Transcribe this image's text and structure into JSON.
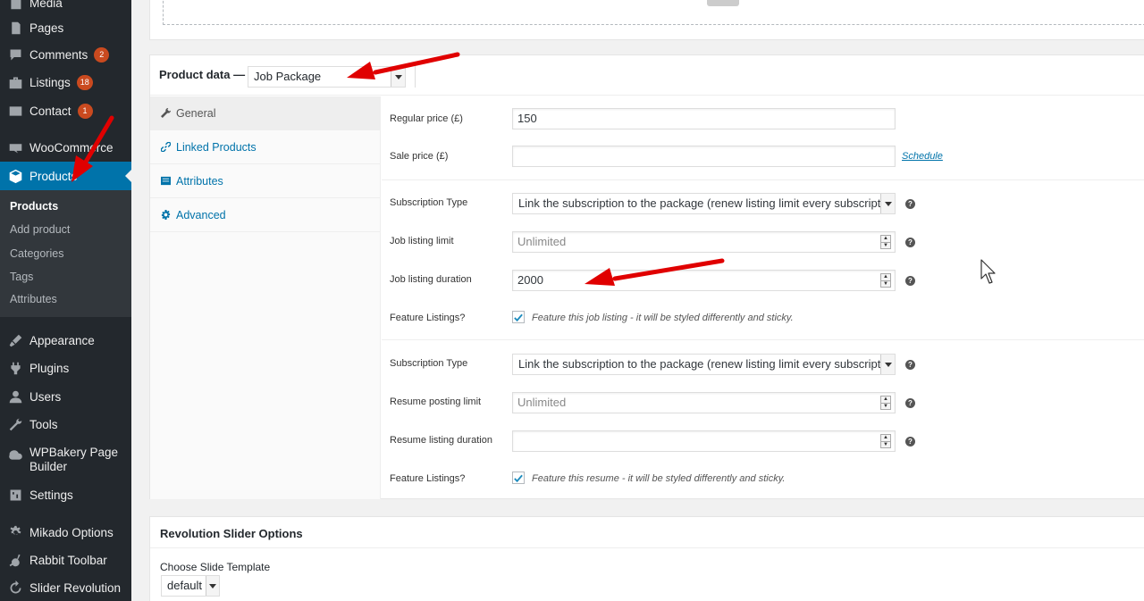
{
  "sidebar": {
    "items": [
      {
        "label": "Media",
        "icon": "media-icon"
      },
      {
        "label": "Pages",
        "icon": "pages-icon"
      },
      {
        "label": "Comments",
        "icon": "comments-icon",
        "badge": "2"
      },
      {
        "label": "Listings",
        "icon": "listings-icon",
        "badge": "18"
      },
      {
        "label": "Contact",
        "icon": "contact-icon",
        "badge": "1"
      },
      {
        "label": "WooCommerce",
        "icon": "woocommerce-icon"
      },
      {
        "label": "Products",
        "icon": "products-icon"
      },
      {
        "label": "Appearance",
        "icon": "appearance-icon"
      },
      {
        "label": "Plugins",
        "icon": "plugins-icon"
      },
      {
        "label": "Users",
        "icon": "users-icon"
      },
      {
        "label": "Tools",
        "icon": "tools-icon"
      },
      {
        "label": "WPBakery Page Builder",
        "icon": "wpbakery-icon"
      },
      {
        "label": "Settings",
        "icon": "settings-icon"
      },
      {
        "label": "Mikado Options",
        "icon": "gear-icon"
      },
      {
        "label": "Rabbit Toolbar",
        "icon": "rabbit-icon"
      },
      {
        "label": "Slider Revolution",
        "icon": "refresh-icon"
      }
    ],
    "submenu": [
      "Products",
      "Add product",
      "Categories",
      "Tags",
      "Attributes"
    ]
  },
  "product_data": {
    "title": "Product data —",
    "type_value": "Job Package",
    "tabs": [
      {
        "label": "General",
        "icon": "wrench-icon"
      },
      {
        "label": "Linked Products",
        "icon": "link-icon"
      },
      {
        "label": "Attributes",
        "icon": "list-icon"
      },
      {
        "label": "Advanced",
        "icon": "gear-icon"
      }
    ],
    "general": {
      "regular_price_label": "Regular price (£)",
      "regular_price_value": "150",
      "sale_price_label": "Sale price (£)",
      "sale_price_value": "",
      "schedule_link": "Schedule"
    },
    "job": {
      "subscription_type_label": "Subscription Type",
      "subscription_type_value": "Link the subscription to the package (renew listing limit every subscription term)",
      "listing_limit_label": "Job listing limit",
      "listing_limit_placeholder": "Unlimited",
      "listing_duration_label": "Job listing duration",
      "listing_duration_value": "2000",
      "feature_label": "Feature Listings?",
      "feature_desc": "Feature this job listing - it will be styled differently and sticky.",
      "feature_checked": true
    },
    "resume": {
      "subscription_type_label": "Subscription Type",
      "subscription_type_value": "Link the subscription to the package (renew listing limit every subscription term)",
      "posting_limit_label": "Resume posting limit",
      "posting_limit_placeholder": "Unlimited",
      "listing_duration_label": "Resume listing duration",
      "listing_duration_value": "",
      "feature_label": "Feature Listings?",
      "feature_desc": "Feature this resume - it will be styled differently and sticky.",
      "feature_checked": true
    },
    "help_glyph": "?"
  },
  "revslider": {
    "title": "Revolution Slider Options",
    "template_label": "Choose Slide Template",
    "template_value": "default"
  },
  "colors": {
    "sidebar_bg": "#23282d",
    "submenu_bg": "#32373c",
    "accent": "#0073aa",
    "badge": "#ca4a1f",
    "annotation_arrow": "#e00000"
  }
}
